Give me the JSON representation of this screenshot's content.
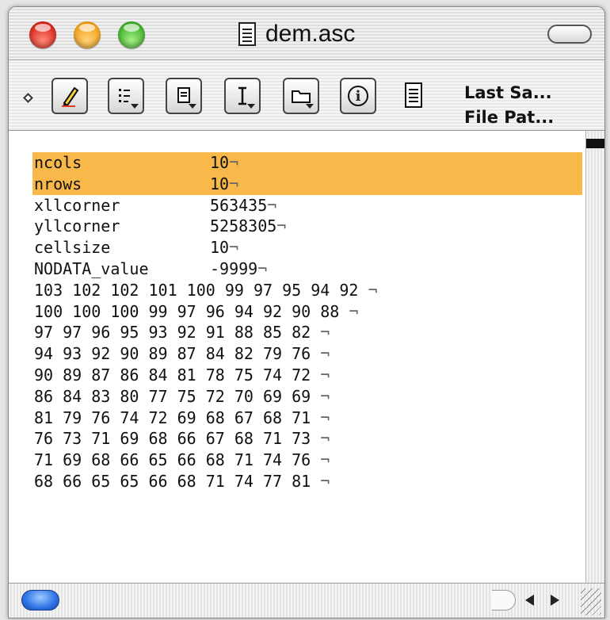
{
  "window": {
    "title": "dem.asc"
  },
  "toolbar": {
    "info_line1": "Last Sa...",
    "info_line2": "File Pat..."
  },
  "file": {
    "header": [
      {
        "key": "ncols",
        "value": "10"
      },
      {
        "key": "nrows",
        "value": "10"
      },
      {
        "key": "xllcorner",
        "value": "563435"
      },
      {
        "key": "yllcorner",
        "value": "5258305"
      },
      {
        "key": "cellsize",
        "value": "10"
      },
      {
        "key": "NODATA_value",
        "value": "-9999"
      }
    ],
    "rows": [
      "103 102 102 101 100 99 97 95 94 92 ",
      "100 100 100 99 97 96 94 92 90 88 ",
      "97 97 96 95 93 92 91 88 85 82 ",
      "94 93 92 90 89 87 84 82 79 76 ",
      "90 89 87 86 84 81 78 75 74 72 ",
      "86 84 83 80 77 75 72 70 69 69 ",
      "81 79 76 74 72 69 68 67 68 71 ",
      "76 73 71 69 68 66 67 68 71 73 ",
      "71 69 68 66 65 66 68 71 74 76 ",
      "68 66 65 65 66 68 71 74 77 81 "
    ],
    "eol_marker": "¬",
    "selected_lines": [
      0,
      1
    ]
  },
  "colors": {
    "selection": "#f8b94a",
    "close": "#d9261c",
    "minimize": "#f2a21a",
    "zoom": "#3fb12b",
    "scroll_thumb": "#2e74e6"
  },
  "icons": [
    "close-button",
    "minimize-button",
    "zoom-button",
    "document-icon",
    "pencil-icon",
    "list-icon",
    "document-menu-icon",
    "text-cursor-icon",
    "folder-icon",
    "info-icon",
    "page-icon",
    "scroll-left-arrow",
    "scroll-right-arrow",
    "resize-grip"
  ]
}
